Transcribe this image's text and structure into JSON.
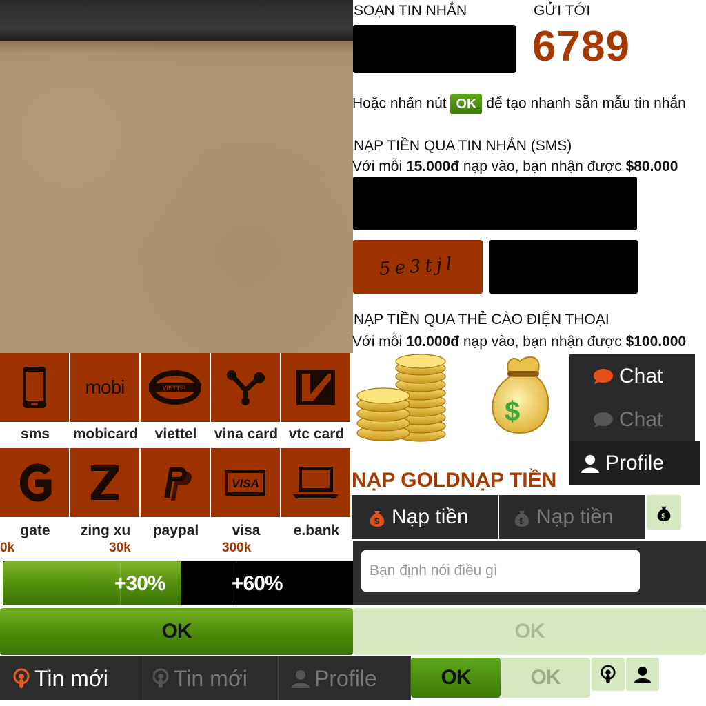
{
  "sms": {
    "compose_label": "SOẠN TIN NHẮN",
    "send_to_label": "GỬI TỚI",
    "send_to_number": "6789",
    "quick_hint_before": "Hoặc nhấn nút",
    "quick_ok": "OK",
    "quick_hint_after": "để tạo nhanh sẵn mẫu tin nhắn"
  },
  "sms_topup": {
    "title": "NẠP TIỀN QUA TIN NHẮN (SMS)",
    "rate_prefix": "Với mỗi",
    "rate_amount": "15.000đ",
    "rate_middle": "nạp vào, bạn nhận được",
    "rate_reward": "$80.000",
    "captcha_text": "5e3tjl"
  },
  "card_topup": {
    "title": "NẠP TIỀN QUA THẺ CÀO ĐIỆN THOẠI",
    "rate_prefix": "Với mỗi",
    "rate_amount": "10.000đ",
    "rate_middle": "nạp vào, bạn nhận được",
    "rate_reward": "$100.000"
  },
  "payment_methods": {
    "row1": [
      "sms",
      "mobicard",
      "viettel",
      "vina card",
      "vtc card"
    ],
    "row2": [
      "gate",
      "zing xu",
      "paypal",
      "visa",
      "e.bank"
    ],
    "mobi_logo": "mobi",
    "viettel_logo": "VIETTEL",
    "visa_logo": "VISA"
  },
  "bonus": {
    "ticks": [
      "0k",
      "30k",
      "300k"
    ],
    "levels": [
      "+30%",
      "+60%"
    ],
    "progress_fraction": 0.51
  },
  "buttons": {
    "ok_big": "OK",
    "ok_big_disabled": "OK",
    "ok_small": "OK",
    "ok_small_disabled": "OK"
  },
  "tabs": {
    "news_active": "Tin mới",
    "news_inactive": "Tin mới",
    "profile": "Profile"
  },
  "side_menu": {
    "chat_active": "Chat",
    "chat_inactive": "Chat",
    "profile": "Profile"
  },
  "gold": {
    "title_gold": "NẠP GOLD",
    "title_money": "NẠP TIỀN",
    "topup_active": "Nạp tiền",
    "topup_inactive": "Nạp tiền"
  },
  "message_input": {
    "placeholder": "Bạn định nói điều gì"
  },
  "colors": {
    "accent_rust": "#9e3300",
    "brand_green": "#4d8b0a",
    "light_green": "#d6e8c0",
    "dark_bg": "#2c2c2c"
  }
}
